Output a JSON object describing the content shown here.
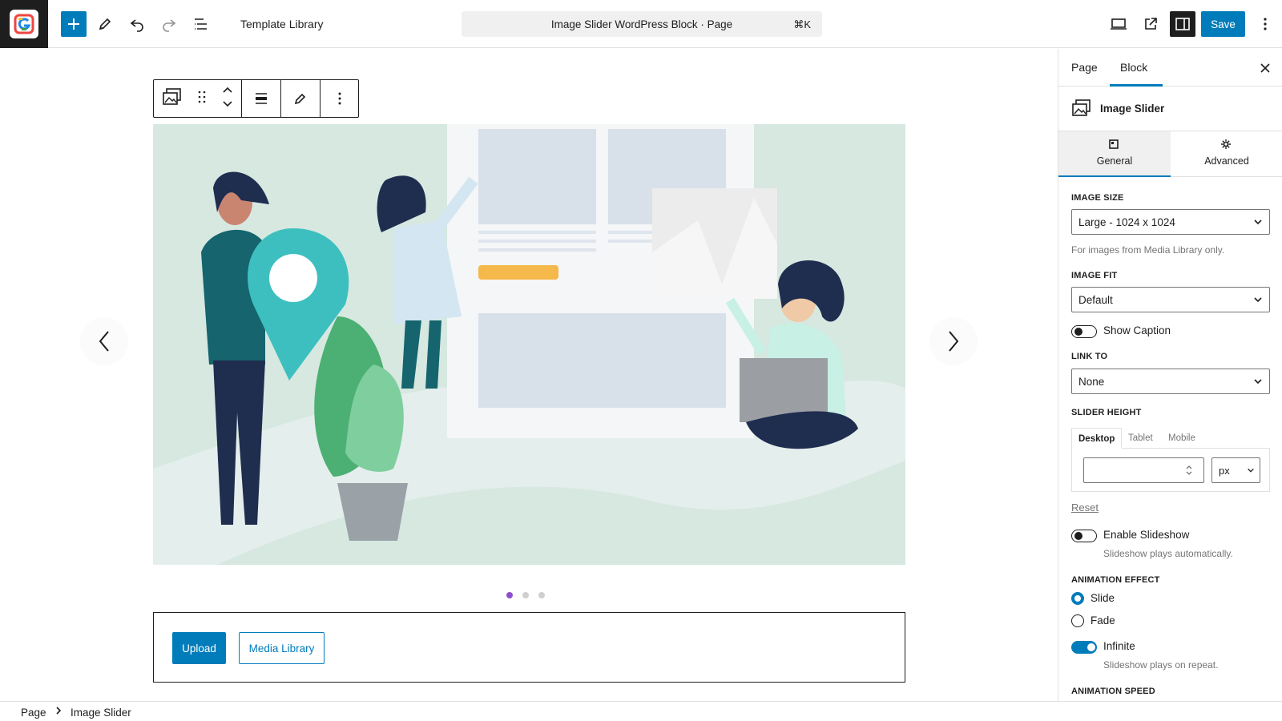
{
  "header": {
    "title": "Template Library",
    "command_text": "Image Slider WordPress Block · Page",
    "command_shortcut": "⌘K",
    "save_label": "Save"
  },
  "canvas": {
    "upload_label": "Upload",
    "media_library_label": "Media Library",
    "slide_count": 3,
    "active_slide": 1
  },
  "breadcrumb": {
    "items": [
      "Page",
      "Image Slider"
    ]
  },
  "sidebar": {
    "tabs": [
      "Page",
      "Block"
    ],
    "active_tab": "Block",
    "block_name": "Image Slider",
    "sub_tabs": [
      "General",
      "Advanced"
    ],
    "active_sub_tab": "General",
    "image_size": {
      "label": "IMAGE SIZE",
      "value": "Large - 1024 x 1024",
      "help": "For images from Media Library only."
    },
    "image_fit": {
      "label": "IMAGE FIT",
      "value": "Default"
    },
    "show_caption": {
      "label": "Show Caption",
      "on": false
    },
    "link_to": {
      "label": "LINK TO",
      "value": "None"
    },
    "slider_height": {
      "label": "SLIDER HEIGHT",
      "devices": [
        "Desktop",
        "Tablet",
        "Mobile"
      ],
      "active_device": "Desktop",
      "value": "",
      "unit": "px",
      "reset_label": "Reset"
    },
    "enable_slideshow": {
      "label": "Enable Slideshow",
      "help": "Slideshow plays automatically.",
      "on": false
    },
    "animation_effect": {
      "label": "ANIMATION EFFECT",
      "options": [
        "Slide",
        "Fade"
      ],
      "selected": "Slide"
    },
    "infinite": {
      "label": "Infinite",
      "help": "Slideshow plays on repeat.",
      "on": true
    },
    "animation_speed": {
      "label": "ANIMATION SPEED"
    }
  },
  "colors": {
    "accent": "#007cba",
    "dot_active": "#8e4fcf",
    "dark": "#1e1e1e"
  }
}
